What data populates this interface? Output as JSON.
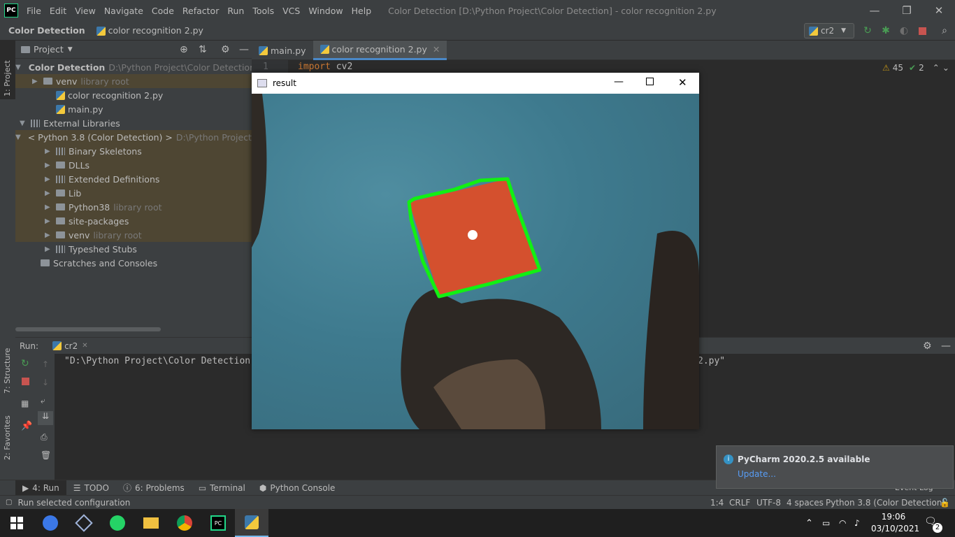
{
  "titlebar": {
    "app_icon": "PC",
    "menu": [
      "File",
      "Edit",
      "View",
      "Navigate",
      "Code",
      "Refactor",
      "Run",
      "Tools",
      "VCS",
      "Window",
      "Help"
    ],
    "window_title": "Color Detection [D:\\Python Project\\Color Detection] - color recognition 2.py",
    "controls": [
      "minimize-icon",
      "restore-icon",
      "close-icon"
    ]
  },
  "navbar": {
    "project": "Color Detection",
    "file": "color recognition 2.py",
    "run_config": "cr2"
  },
  "left_stripe": {
    "project_label": "1: Project",
    "structure_label": "7: Structure",
    "favorites_label": "2: Favorites"
  },
  "project_panel": {
    "title": "Project",
    "tree": [
      {
        "label": "Color Detection",
        "extra": "D:\\Python Project\\Color Detection",
        "icon": "folder-icon",
        "arrow": "down"
      },
      {
        "label": "venv",
        "extra": "library root",
        "icon": "folder-icon",
        "arrow": "right"
      },
      {
        "label": "color recognition 2.py",
        "extra": "",
        "icon": "python-file-icon",
        "arrow": ""
      },
      {
        "label": "main.py",
        "extra": "",
        "icon": "python-file-icon",
        "arrow": ""
      },
      {
        "label": "External Libraries",
        "extra": "",
        "icon": "library-icon",
        "arrow": "down"
      },
      {
        "label": "< Python 3.8 (Color Detection) >",
        "extra": "D:\\Python Project\\",
        "icon": "python-icon",
        "arrow": "down"
      },
      {
        "label": "Binary Skeletons",
        "extra": "",
        "icon": "library-icon",
        "arrow": "right"
      },
      {
        "label": "DLLs",
        "extra": "",
        "icon": "folder-icon",
        "arrow": "right"
      },
      {
        "label": "Extended Definitions",
        "extra": "",
        "icon": "library-icon",
        "arrow": "right"
      },
      {
        "label": "Lib",
        "extra": "",
        "icon": "folder-icon",
        "arrow": "right"
      },
      {
        "label": "Python38",
        "extra": "library root",
        "icon": "folder-icon",
        "arrow": "right"
      },
      {
        "label": "site-packages",
        "extra": "",
        "icon": "folder-icon",
        "arrow": "right"
      },
      {
        "label": "venv",
        "extra": "library root",
        "icon": "folder-icon",
        "arrow": "right"
      },
      {
        "label": "Typeshed Stubs",
        "extra": "",
        "icon": "library-icon",
        "arrow": "right"
      },
      {
        "label": "Scratches and Consoles",
        "extra": "",
        "icon": "scratches-icon",
        "arrow": ""
      }
    ]
  },
  "editor": {
    "tabs": [
      {
        "label": "main.py",
        "active": false
      },
      {
        "label": "color recognition 2.py",
        "active": true
      }
    ],
    "line_number": "1",
    "code_keyword": "import",
    "code_rest": " cv2",
    "warnings": "45",
    "checks": "2"
  },
  "run_panel": {
    "label": "Run:",
    "tab": "cr2",
    "console_line_start": "\"D:\\Python Project\\Color Detection",
    "console_line_end": "2.py\""
  },
  "result_window": {
    "title": "result"
  },
  "bottom_tools": [
    {
      "label": "4: Run",
      "icon": "play-icon",
      "active": true
    },
    {
      "label": "TODO",
      "icon": "list-icon",
      "active": false
    },
    {
      "label": "6: Problems",
      "icon": "info-icon",
      "active": false
    },
    {
      "label": "Terminal",
      "icon": "terminal-icon",
      "active": false
    },
    {
      "label": "Python Console",
      "icon": "python-icon",
      "active": false
    }
  ],
  "event_log": "Event Log",
  "statusbar": {
    "message": "Run selected configuration",
    "position": "1:4",
    "line_sep": "CRLF",
    "encoding": "UTF-8",
    "indent": "4 spaces",
    "interpreter": "Python 3.8 (Color Detection)"
  },
  "notification": {
    "title": "PyCharm 2020.2.5 available",
    "link": "Update..."
  },
  "taskbar": {
    "time": "19:06",
    "date": "03/10/2021",
    "notifications": "2",
    "apps": [
      "windows-start-icon",
      "browser-icon",
      "virtualbox-icon",
      "whatsapp-icon",
      "file-explorer-icon",
      "chrome-icon",
      "pycharm-icon",
      "python-icon"
    ]
  }
}
